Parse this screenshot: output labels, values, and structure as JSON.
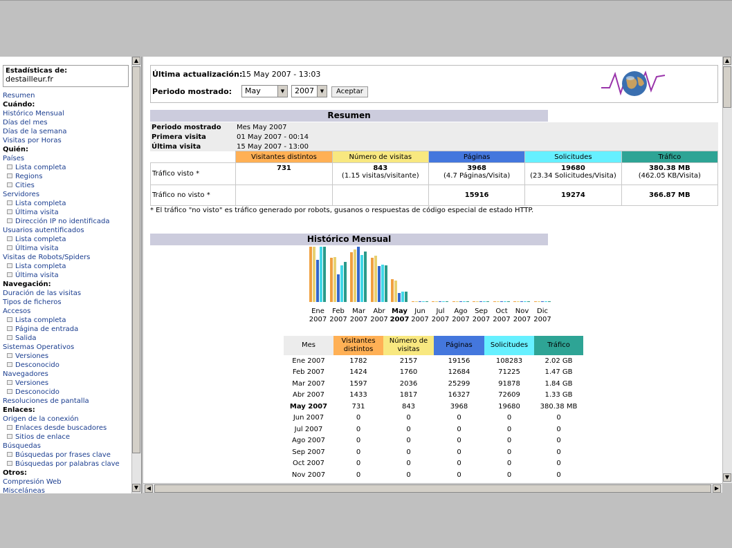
{
  "sidebar": {
    "stats_title": "Estadísticas de:",
    "site": "destailleur.fr",
    "items": [
      {
        "type": "link",
        "label": "Resumen"
      },
      {
        "type": "header",
        "label": "Cuándo:"
      },
      {
        "type": "link",
        "label": "Histórico Mensual"
      },
      {
        "type": "link",
        "label": "Días del mes"
      },
      {
        "type": "link",
        "label": "Días de la semana"
      },
      {
        "type": "link",
        "label": "Visitas por Horas"
      },
      {
        "type": "header",
        "label": "Quién:"
      },
      {
        "type": "link",
        "label": "Países"
      },
      {
        "type": "sub",
        "label": "Lista completa"
      },
      {
        "type": "sub",
        "label": "Regions"
      },
      {
        "type": "sub",
        "label": "Cities"
      },
      {
        "type": "link",
        "label": "Servidores"
      },
      {
        "type": "sub",
        "label": "Lista completa"
      },
      {
        "type": "sub",
        "label": "Última visita"
      },
      {
        "type": "sub",
        "label": "Dirección IP no identificada"
      },
      {
        "type": "link",
        "label": "Usuarios autentificados"
      },
      {
        "type": "sub",
        "label": "Lista completa"
      },
      {
        "type": "sub",
        "label": "Última visita"
      },
      {
        "type": "link",
        "label": "Visitas de Robots/Spiders"
      },
      {
        "type": "sub",
        "label": "Lista completa"
      },
      {
        "type": "sub",
        "label": "Última visita"
      },
      {
        "type": "header",
        "label": "Navegación:"
      },
      {
        "type": "link",
        "label": "Duración de las visitas"
      },
      {
        "type": "link",
        "label": "Tipos de ficheros"
      },
      {
        "type": "link",
        "label": "Accesos"
      },
      {
        "type": "sub",
        "label": "Lista completa"
      },
      {
        "type": "sub",
        "label": "Página de entrada"
      },
      {
        "type": "sub",
        "label": "Salida"
      },
      {
        "type": "link",
        "label": "Sistemas Operativos"
      },
      {
        "type": "sub",
        "label": "Versiones"
      },
      {
        "type": "sub",
        "label": "Desconocido"
      },
      {
        "type": "link",
        "label": "Navegadores"
      },
      {
        "type": "sub",
        "label": "Versiones"
      },
      {
        "type": "sub",
        "label": "Desconocido"
      },
      {
        "type": "link",
        "label": "Resoluciones de pantalla"
      },
      {
        "type": "header",
        "label": "Enlaces:"
      },
      {
        "type": "link",
        "label": "Origen de la conexión"
      },
      {
        "type": "sub",
        "label": "Enlaces desde buscadores"
      },
      {
        "type": "sub",
        "label": "Sitios de enlace"
      },
      {
        "type": "link",
        "label": "Búsquedas"
      },
      {
        "type": "sub",
        "label": "Búsquedas por frases clave"
      },
      {
        "type": "sub",
        "label": "Búsquedas por palabras clave"
      },
      {
        "type": "header",
        "label": "Otros:"
      },
      {
        "type": "link",
        "label": "Compresión Web"
      },
      {
        "type": "link",
        "label": "Misceláneas"
      }
    ]
  },
  "header": {
    "update_label": "Última actualización:",
    "update_value": "15 May 2007 - 13:03",
    "period_label": "Periodo mostrado:",
    "month_select": "May",
    "year_select": "2007",
    "accept_button": "Aceptar"
  },
  "summary": {
    "title": "Resumen",
    "rows": [
      {
        "k": "Periodo mostrado",
        "v": "Mes May 2007"
      },
      {
        "k": "Primera visita",
        "v": "01 May 2007 - 00:14"
      },
      {
        "k": "Última visita",
        "v": "15 May 2007 - 13:00"
      }
    ],
    "columns": [
      "Visitantes distintos",
      "Número de visitas",
      "Páginas",
      "Solicitudes",
      "Tráfico"
    ],
    "seen_label": "Tráfico visto *",
    "seen": [
      {
        "v": "731",
        "s": ""
      },
      {
        "v": "843",
        "s": "(1.15 visitas/visitante)"
      },
      {
        "v": "3968",
        "s": "(4.7 Páginas/Visita)"
      },
      {
        "v": "19680",
        "s": "(23.34 Solicitudes/Visita)"
      },
      {
        "v": "380.38 MB",
        "s": "(462.05 KB/Visita)"
      }
    ],
    "unseen_label": "Tráfico no visto *",
    "unseen": [
      "",
      "",
      "15916",
      "19274",
      "366.87 MB"
    ],
    "note": "* El tráfico \"no visto\" es tráfico generado por robots, gusanos o respuestas de código especial de estado HTTP."
  },
  "history": {
    "title": "Histórico Mensual",
    "columns": [
      "Mes",
      "Visitantes distintos",
      "Número de visitas",
      "Páginas",
      "Solicitudes",
      "Tráfico"
    ],
    "rows": [
      [
        "Ene 2007",
        "1782",
        "2157",
        "19156",
        "108283",
        "2.02 GB"
      ],
      [
        "Feb 2007",
        "1424",
        "1760",
        "12684",
        "71225",
        "1.47 GB"
      ],
      [
        "Mar 2007",
        "1597",
        "2036",
        "25299",
        "91878",
        "1.84 GB"
      ],
      [
        "Abr 2007",
        "1433",
        "1817",
        "16327",
        "72609",
        "1.33 GB"
      ],
      [
        "May 2007",
        "731",
        "843",
        "3968",
        "19680",
        "380.38 MB"
      ],
      [
        "Jun 2007",
        "0",
        "0",
        "0",
        "0",
        "0"
      ],
      [
        "Jul 2007",
        "0",
        "0",
        "0",
        "0",
        "0"
      ],
      [
        "Ago 2007",
        "0",
        "0",
        "0",
        "0",
        "0"
      ],
      [
        "Sep 2007",
        "0",
        "0",
        "0",
        "0",
        "0"
      ],
      [
        "Oct 2007",
        "0",
        "0",
        "0",
        "0",
        "0"
      ],
      [
        "Nov 2007",
        "0",
        "0",
        "0",
        "0",
        "0"
      ]
    ]
  },
  "chart_data": {
    "type": "bar",
    "categories": [
      "Ene",
      "Feb",
      "Mar",
      "Abr",
      "May",
      "Jun",
      "Jul",
      "Ago",
      "Sep",
      "Oct",
      "Nov",
      "Dic"
    ],
    "year": "2007",
    "series": [
      {
        "name": "Visitantes distintos",
        "color": "#f0a040",
        "values": [
          1782,
          1424,
          1597,
          1433,
          731,
          0,
          0,
          0,
          0,
          0,
          0,
          0
        ]
      },
      {
        "name": "Número de visitas",
        "color": "#e8d070",
        "values": [
          2157,
          1760,
          2036,
          1817,
          843,
          0,
          0,
          0,
          0,
          0,
          0,
          0
        ]
      },
      {
        "name": "Páginas",
        "color": "#3366cc",
        "values": [
          19156,
          12684,
          25299,
          16327,
          3968,
          0,
          0,
          0,
          0,
          0,
          0,
          0
        ]
      },
      {
        "name": "Solicitudes",
        "color": "#40d8e8",
        "values": [
          108283,
          71225,
          91878,
          72609,
          19680,
          0,
          0,
          0,
          0,
          0,
          0,
          0
        ]
      },
      {
        "name": "Tráfico (MB)",
        "color": "#2a9a8a",
        "values": [
          2068,
          1505,
          1884,
          1362,
          380.38,
          0,
          0,
          0,
          0,
          0,
          0,
          0
        ]
      }
    ],
    "highlight": "May"
  }
}
